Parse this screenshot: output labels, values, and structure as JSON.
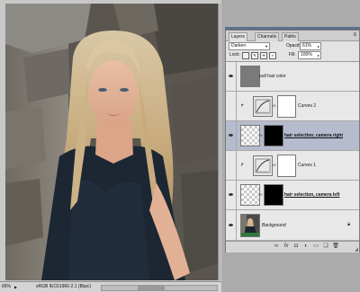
{
  "statusbar": {
    "zoom": "66%",
    "doc_info": "sRGB IEC61966-2.1 (8bpc)"
  },
  "layers_panel": {
    "tabs": [
      "Layers",
      "Channels",
      "Paths"
    ],
    "active_tab": "Layers",
    "blend_mode": "Darken",
    "opacity_label": "Opacity:",
    "opacity_value": "61%",
    "lock_label": "Lock:",
    "fill_label": "Fill:",
    "fill_value": "100%",
    "layers": [
      {
        "name": "pull hair color",
        "style": "normal",
        "visible": true,
        "selected": false,
        "thumb": "color-fill",
        "thumb_color": "#7a7a7a"
      },
      {
        "name": "Curves 2",
        "style": "normal",
        "visible": false,
        "selected": false,
        "thumb": "curves",
        "clipped": true
      },
      {
        "name": "hair selection, camera right",
        "style": "bold",
        "visible": true,
        "selected": true,
        "thumb": "mask-right"
      },
      {
        "name": "Curves 1",
        "style": "normal",
        "visible": false,
        "selected": false,
        "thumb": "curves",
        "clipped": true
      },
      {
        "name": "hair selection, camera left",
        "style": "bold",
        "visible": true,
        "selected": false,
        "thumb": "mask-left"
      },
      {
        "name": "Background",
        "style": "italic",
        "visible": true,
        "selected": false,
        "thumb": "photo",
        "locked": true
      }
    ]
  },
  "colors": {
    "panel_bg": "#e3e3e3",
    "selected_layer": "#b5bccd",
    "title_accent": "#5d6f8d"
  }
}
